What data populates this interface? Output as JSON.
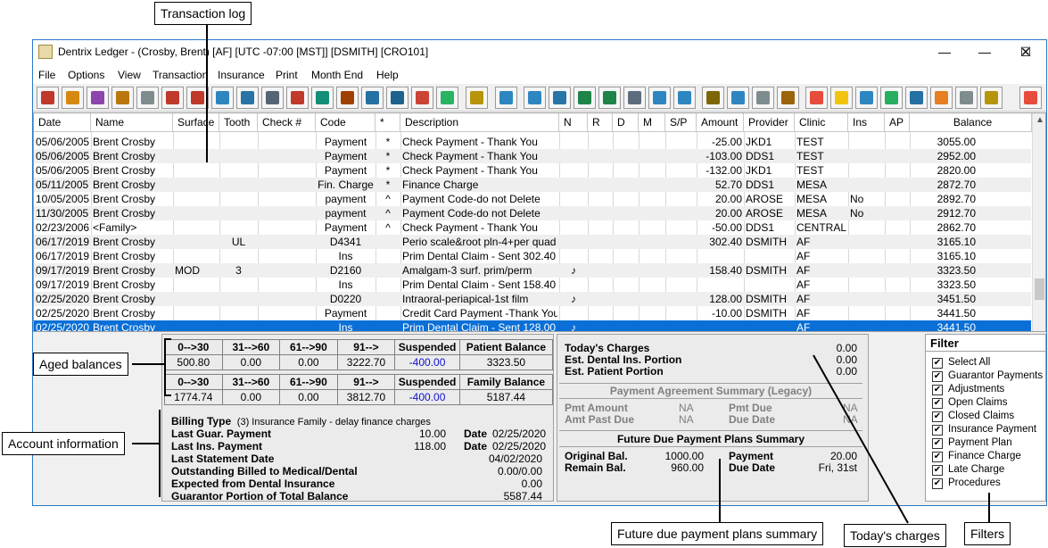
{
  "window": {
    "title": "Dentrix Ledger - (Crosby, Brent) [AF] [UTC -07:00 [MST]] [DSMITH] [CRO101]",
    "minimize": "—",
    "maximize": "☐",
    "close": "✕"
  },
  "menu": [
    "File",
    "Options",
    "View",
    "Transaction",
    "Insurance",
    "Print",
    "Month End",
    "Help"
  ],
  "toolbar_icons": [
    "patient-icon",
    "folder-icon",
    "book-icon",
    "chair-icon",
    "pen-icon",
    "card-icon",
    "card-red-icon",
    "note-icon",
    "email-icon",
    "list-icon",
    "rx-icon",
    "pencil-icon",
    "stack-icon",
    "transfer-icon",
    "tooth-icon",
    "apple-icon",
    "chat-icon",
    "bank-icon",
    "person-icon",
    "refresh-icon",
    "g-icon",
    "pen-green-icon",
    "g-green-icon",
    "claim-icon",
    "ins-icon",
    "ins-batch-icon",
    "walk-icon",
    "letter-icon",
    "family-icon",
    "door-icon",
    "medical-icon",
    "notes-icon",
    "calc-icon",
    "arrow-icon",
    "info-icon",
    "dollar-help-icon",
    "family-card-icon",
    "people-icon",
    "chart-icon",
    "report-icon",
    "sign-icon",
    "ins-doc-icon",
    "exit-icon"
  ],
  "columns": [
    "Date",
    "Name",
    "Surface",
    "Tooth",
    "Check #",
    "Code",
    "*",
    "Description",
    "N",
    "R",
    "D",
    "M",
    "S/P",
    "Amount",
    "Provider",
    "Clinic",
    "Ins",
    "AP",
    "Balance"
  ],
  "rows": [
    {
      "date": "05/06/2005",
      "name": "Brent Crosby",
      "surface": "",
      "tooth": "",
      "check": "",
      "code": "Payment",
      "star": "*",
      "desc": "Check Payment - Thank You",
      "n": "",
      "amount": "-25.00",
      "provider": "JKD1",
      "clinic": "TEST",
      "ins": "",
      "balance": "3055.00"
    },
    {
      "date": "05/06/2005",
      "name": "Brent Crosby",
      "surface": "",
      "tooth": "",
      "check": "",
      "code": "Payment",
      "star": "*",
      "desc": "Check Payment - Thank You",
      "n": "",
      "amount": "-103.00",
      "provider": "DDS1",
      "clinic": "TEST",
      "ins": "",
      "balance": "2952.00"
    },
    {
      "date": "05/06/2005",
      "name": "Brent Crosby",
      "surface": "",
      "tooth": "",
      "check": "",
      "code": "Payment",
      "star": "*",
      "desc": "Check Payment - Thank You",
      "n": "",
      "amount": "-132.00",
      "provider": "JKD1",
      "clinic": "TEST",
      "ins": "",
      "balance": "2820.00"
    },
    {
      "date": "05/11/2005",
      "name": "Brent Crosby",
      "surface": "",
      "tooth": "",
      "check": "",
      "code": "Fin. Charge",
      "star": "*",
      "desc": "Finance Charge",
      "n": "",
      "amount": "52.70",
      "provider": "DDS1",
      "clinic": "MESA",
      "ins": "",
      "balance": "2872.70"
    },
    {
      "date": "10/05/2005",
      "name": "Brent Crosby",
      "surface": "",
      "tooth": "",
      "check": "",
      "code": "payment",
      "star": "^",
      "desc": "Payment Code-do not Delete",
      "n": "",
      "amount": "20.00",
      "provider": "AROSE",
      "clinic": "MESA",
      "ins": "No",
      "balance": "2892.70"
    },
    {
      "date": "11/30/2005",
      "name": "Brent Crosby",
      "surface": "",
      "tooth": "",
      "check": "",
      "code": "payment",
      "star": "^",
      "desc": "Payment Code-do not Delete",
      "n": "",
      "amount": "20.00",
      "provider": "AROSE",
      "clinic": "MESA",
      "ins": "No",
      "balance": "2912.70"
    },
    {
      "date": "02/23/2006",
      "name": "<Family>",
      "surface": "",
      "tooth": "",
      "check": "",
      "code": "Payment",
      "star": "^",
      "desc": "Check Payment - Thank You",
      "n": "",
      "amount": "-50.00",
      "provider": "DDS1",
      "clinic": "CENTRAL",
      "ins": "",
      "balance": "2862.70"
    },
    {
      "date": "06/17/2019",
      "name": "Brent Crosby",
      "surface": "",
      "tooth": "UL",
      "check": "",
      "code": "D4341",
      "star": "",
      "desc": "Perio scale&root pln-4+per quad",
      "n": "",
      "amount": "302.40",
      "provider": "DSMITH",
      "clinic": "AF",
      "ins": "",
      "balance": "3165.10"
    },
    {
      "date": "06/17/2019",
      "name": "Brent Crosby",
      "surface": "",
      "tooth": "",
      "check": "",
      "code": "Ins",
      "star": "",
      "desc": "Prim Dental Claim - Sent 302.40",
      "n": "",
      "amount": "",
      "provider": "",
      "clinic": "AF",
      "ins": "",
      "balance": "3165.10"
    },
    {
      "date": "09/17/2019",
      "name": "Brent Crosby",
      "surface": "MOD",
      "tooth": "3",
      "check": "",
      "code": "D2160",
      "star": "",
      "desc": "Amalgam-3 surf. prim/perm",
      "n": "♪",
      "amount": "158.40",
      "provider": "DSMITH",
      "clinic": "AF",
      "ins": "",
      "balance": "3323.50"
    },
    {
      "date": "09/17/2019",
      "name": "Brent Crosby",
      "surface": "",
      "tooth": "",
      "check": "",
      "code": "Ins",
      "star": "",
      "desc": "Prim Dental Claim - Sent 158.40",
      "n": "",
      "amount": "",
      "provider": "",
      "clinic": "AF",
      "ins": "",
      "balance": "3323.50"
    },
    {
      "date": "02/25/2020",
      "name": "Brent Crosby",
      "surface": "",
      "tooth": "",
      "check": "",
      "code": "D0220",
      "star": "",
      "desc": "Intraoral-periapical-1st film",
      "n": "♪",
      "amount": "128.00",
      "provider": "DSMITH",
      "clinic": "AF",
      "ins": "",
      "balance": "3451.50"
    },
    {
      "date": "02/25/2020",
      "name": "Brent Crosby",
      "surface": "",
      "tooth": "",
      "check": "",
      "code": "Payment",
      "star": "",
      "desc": "Credit Card Payment -Thank You",
      "n": "",
      "amount": "-10.00",
      "provider": "DSMITH",
      "clinic": "AF",
      "ins": "",
      "balance": "3441.50"
    },
    {
      "date": "02/25/2020",
      "name": "Brent Crosby",
      "surface": "",
      "tooth": "",
      "check": "",
      "code": "Ins",
      "star": "",
      "desc": "Prim Dental Claim - Sent 128.00",
      "n": "♪",
      "amount": "",
      "provider": "",
      "clinic": "AF",
      "ins": "",
      "balance": "3441.50"
    }
  ],
  "aged": {
    "patient_headers": [
      "0-->30",
      "31-->60",
      "61-->90",
      "91-->",
      "Suspended",
      "Patient Balance"
    ],
    "patient_values": [
      "500.80",
      "0.00",
      "0.00",
      "3222.70",
      "-400.00",
      "3323.50"
    ],
    "family_headers": [
      "0-->30",
      "31-->60",
      "61-->90",
      "91-->",
      "Suspended",
      "Family Balance"
    ],
    "family_values": [
      "1774.74",
      "0.00",
      "0.00",
      "3812.70",
      "-400.00",
      "5187.44"
    ]
  },
  "account": {
    "billing_type_label": "Billing Type",
    "billing_type_value": "(3) Insurance Family - delay finance charges",
    "last_guar_label": "Last Guar. Payment",
    "last_guar_amount": "10.00",
    "last_guar_date_label": "Date",
    "last_guar_date": "02/25/2020",
    "last_ins_label": "Last Ins. Payment",
    "last_ins_amount": "118.00",
    "last_ins_date_label": "Date",
    "last_ins_date": "02/25/2020",
    "last_stmt_label": "Last Statement Date",
    "last_stmt_value": "04/02/2020",
    "outstanding_label": "Outstanding Billed to Medical/Dental",
    "outstanding_value": "0.00/0.00",
    "expected_label": "Expected from Dental Insurance",
    "expected_value": "0.00",
    "guar_portion_label": "Guarantor Portion of Total Balance",
    "guar_portion_value": "5587.44"
  },
  "today": {
    "charges_label": "Today's Charges",
    "charges_value": "0.00",
    "ins_label": "Est. Dental Ins. Portion",
    "ins_value": "0.00",
    "patient_label": "Est. Patient Portion",
    "patient_value": "0.00"
  },
  "payment_agreement": {
    "title": "Payment Agreement Summary (Legacy)",
    "pmt_amount_label": "Pmt Amount",
    "pmt_amount": "NA",
    "pmt_due_label": "Pmt Due",
    "pmt_due": "NA",
    "past_due_label": "Amt Past Due",
    "past_due": "NA",
    "due_date_label": "Due Date",
    "due_date": "NA"
  },
  "future_plans": {
    "title": "Future Due Payment Plans Summary",
    "original_label": "Original Bal.",
    "original": "1000.00",
    "payment_label": "Payment",
    "payment": "20.00",
    "remain_label": "Remain Bal.",
    "remain": "960.00",
    "due_date_label": "Due Date",
    "due_date": "Fri, 31st"
  },
  "filter": {
    "title": "Filter",
    "items": [
      "Select All",
      "Guarantor Payments",
      "Adjustments",
      "Open Claims",
      "Closed Claims",
      "Insurance Payment",
      "Payment Plan",
      "Finance Charge",
      "Late Charge",
      "Procedures"
    ]
  },
  "callouts": {
    "transaction_log": "Transaction log",
    "aged_balances": "Aged balances",
    "account_information": "Account information",
    "future_due": "Future due payment plans summary",
    "todays_charges": "Today's charges",
    "filters": "Filters"
  }
}
